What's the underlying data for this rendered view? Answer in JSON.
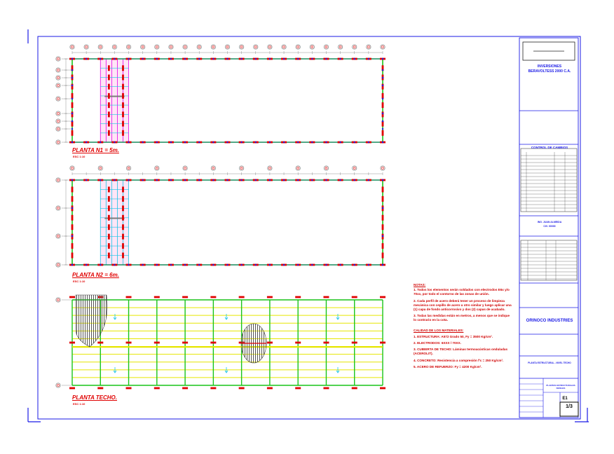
{
  "titles": {
    "plan1": "PLANTA N1 = 5m.",
    "plan1_scale": "ESC 1:10",
    "plan2": "PLANTA N2 = 6m.",
    "plan2_scale": "ESC 1:10",
    "plan3": "PLANTA TECHO.",
    "plan3_scale": "ESC 1:10"
  },
  "notes": {
    "heading": "NOTAS:",
    "items": [
      "1. Todos los elementos serán soldados con electrodos E6x y/o 70xx, por todo el contorno de las zonas de unión.",
      "2. Cada perfil de acero deberá tener un proceso de limpieza mecánica con cepillo de acero u otro similar y luego aplicar una (1) capa de fondo anticorrosivo y dos (2) capas de acabado.",
      "3. Todas las medidas están en metros, a menos que se indique lo contrario en la cota."
    ],
    "materials_heading": "CALIDAD DE LOS MATERIALES:",
    "materials": [
      "1. ESTRUCTURA: A572 Grado 50, Fy = 3500 Kg/cm².",
      "2. ELECTRODOS: 6XXX / 70XX.",
      "3. CUBIERTA DE TECHO: Láminas termoacústicas onduladas (ACEROLIT).",
      "4. CONCRETO: Resistencia a compresión f'c = 250 Kg/cm².",
      "5. ACERO DE REFUERZO: Fy = 4200 Kg/cm²."
    ]
  },
  "titleblock": {
    "company_line1": "INVERSIONES",
    "company_line2": "BERAVOLTESS 2000 C.A.",
    "changes_heading": "CONTROL DE CAMBIOS",
    "engineer_line1": "ING. JUAN ALMEIDA",
    "engineer_line2": "CIV. 00000",
    "project": "ORINOCO INDUSTRIES",
    "drawing_title": "PLANTA ESTRUCTURAL - NIVEL TECHO",
    "sheet_label": "PLANTAS ESTRUCTURALES NIVELES",
    "sheet_number": "1/3",
    "sheet_total": "E1"
  },
  "colors": {
    "frame": "#1a1ae6",
    "beam_red": "#e00000",
    "beam_green": "#19c419",
    "beam_blue": "#1a1ae6",
    "magenta": "#e600e6",
    "cyan": "#19c4e6",
    "yellow": "#e6e600",
    "grey": "#7a7a7a"
  }
}
